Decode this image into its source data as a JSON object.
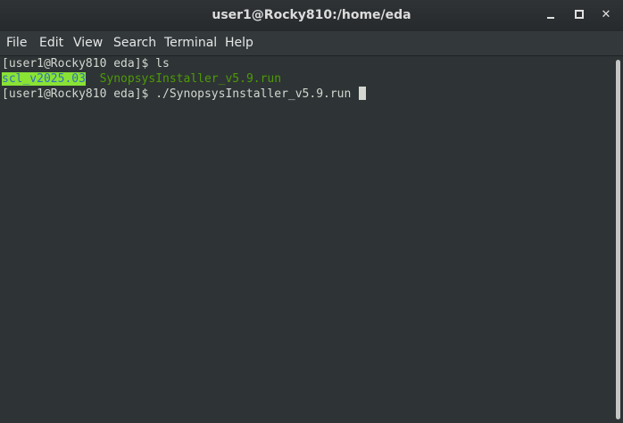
{
  "window": {
    "title": "user1@Rocky810:/home/eda",
    "controls": {
      "minimize_icon": "minimize-icon",
      "maximize_icon": "maximize-icon",
      "close_icon": "close-icon",
      "close_glyph": "✕"
    }
  },
  "menubar": {
    "items": [
      "File",
      "Edit",
      "View",
      "Search",
      "Terminal",
      "Help"
    ]
  },
  "terminal": {
    "lines": [
      {
        "prompt": "[user1@Rocky810 eda]$ ",
        "command": "ls"
      },
      {
        "entries": [
          "scl_v2025.03",
          "SynopsysInstaller_v5.9.run"
        ],
        "separator": "  "
      },
      {
        "prompt": "[user1@Rocky810 eda]$ ",
        "command": "./SynopsysInstaller_v5.9.run "
      }
    ]
  },
  "colors": {
    "terminal_bg": "#2e3436",
    "terminal_fg": "#d3d7cf",
    "directory_highlight_bg": "#8ae234",
    "directory_highlight_fg": "#2e73b8",
    "executable": "#4e9a06"
  }
}
